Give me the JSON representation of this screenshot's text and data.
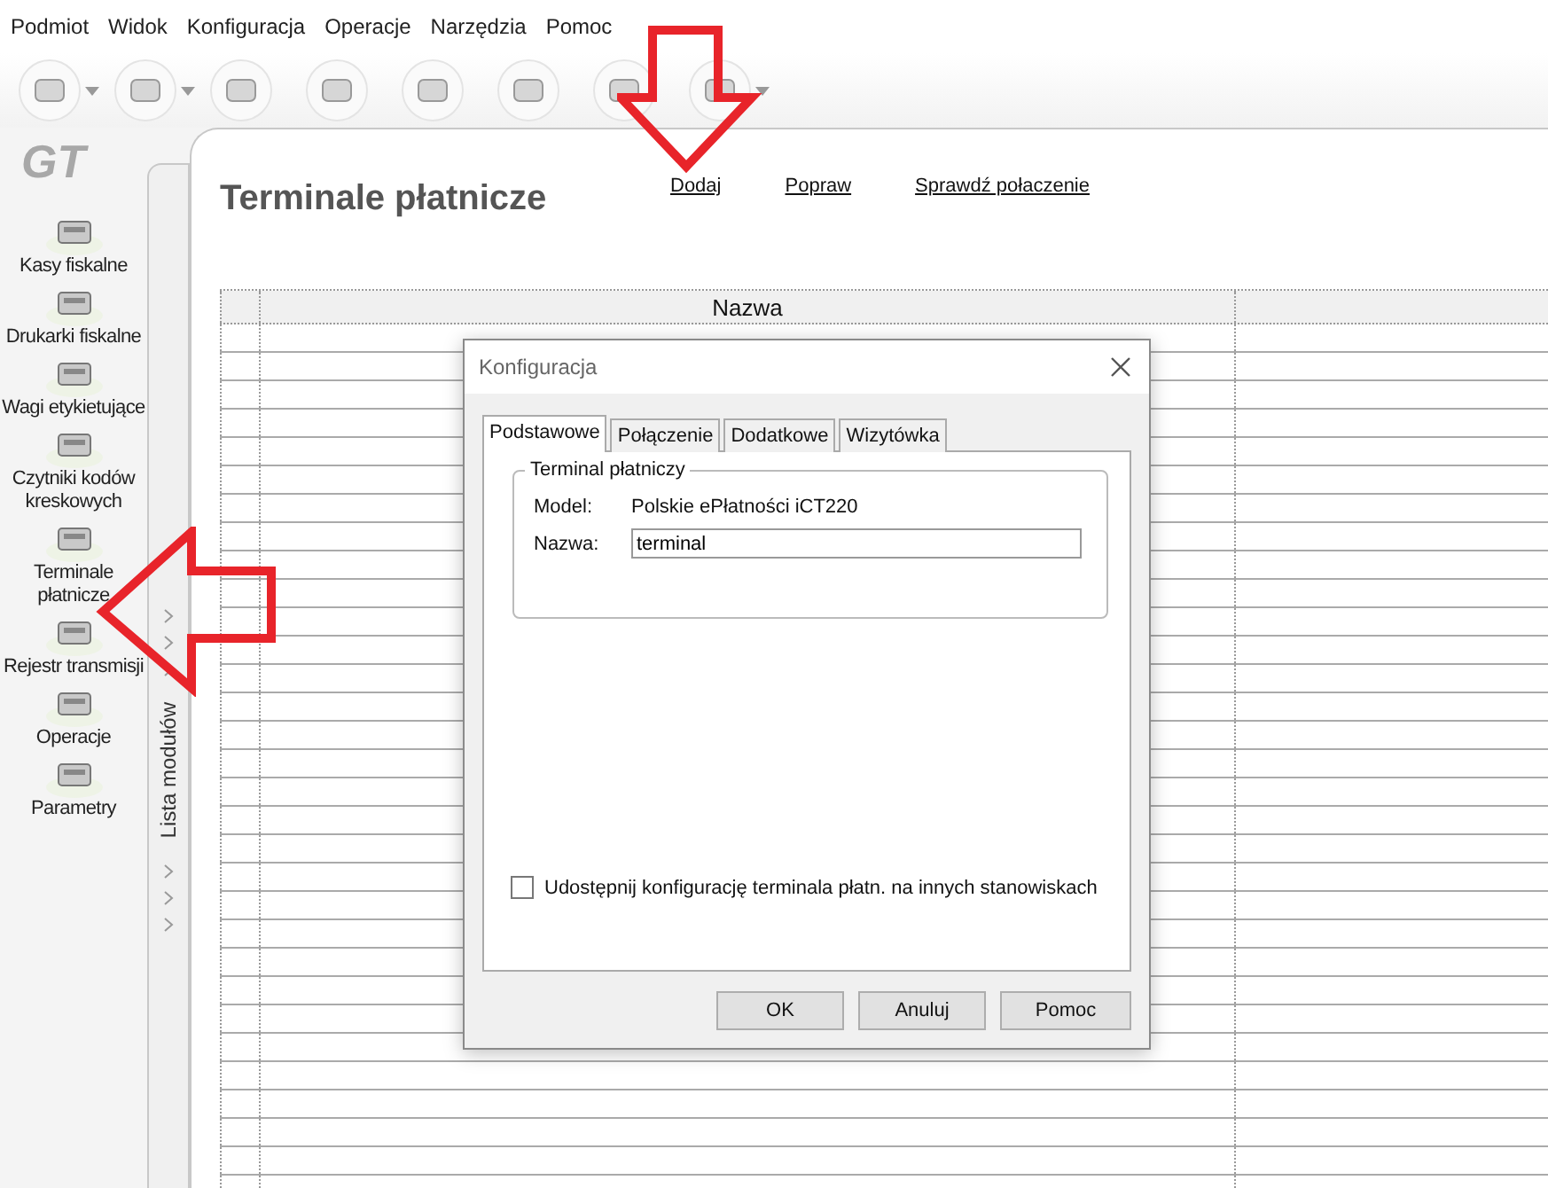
{
  "menu": [
    "Podmiot",
    "Widok",
    "Konfiguracja",
    "Operacje",
    "Narzędzia",
    "Pomoc"
  ],
  "logo": "GT",
  "sidebar": {
    "items": [
      {
        "label": "Kasy fiskalne"
      },
      {
        "label": "Drukarki fiskalne"
      },
      {
        "label": "Wagi etykietujące"
      },
      {
        "label": "Czytniki kodów kreskowych"
      },
      {
        "label": "Terminale płatnicze"
      },
      {
        "label": "Rejestr transmisji"
      },
      {
        "label": "Operacje"
      },
      {
        "label": "Parametry"
      }
    ],
    "strip_label": "Lista modułów"
  },
  "page": {
    "title": "Terminale płatnicze",
    "links": [
      "Dodaj",
      "Popraw",
      "Sprawdź połaczenie"
    ],
    "table": {
      "columns": [
        {
          "label": "Nazwa"
        }
      ]
    }
  },
  "dialog": {
    "title": "Konfiguracja",
    "tabs": [
      {
        "label": "Podstawowe",
        "selected": true
      },
      {
        "label": "Połączenie",
        "selected": false
      },
      {
        "label": "Dodatkowe",
        "selected": false
      },
      {
        "label": "Wizytówka",
        "selected": false
      }
    ],
    "group": "Terminal płatniczy",
    "fields": [
      {
        "kind": "text",
        "label": "Model:",
        "value": "Polskie ePłatności iCT220"
      },
      {
        "kind": "input",
        "label": "Nazwa:",
        "value": "terminal"
      }
    ],
    "checkbox": {
      "label": "Udostępnij konfigurację terminala płatn. na innych stanowiskach",
      "checked": false
    },
    "buttons": [
      "OK",
      "Anuluj",
      "Pomoc"
    ]
  }
}
